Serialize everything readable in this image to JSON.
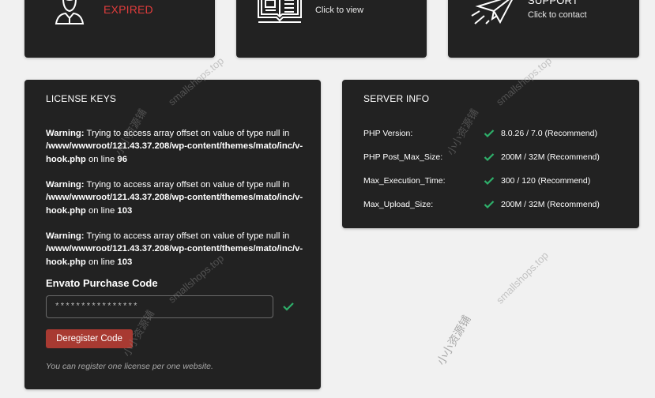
{
  "top_cards": {
    "license_status": {
      "status": "EXPIRED",
      "icon": "user-icon",
      "status_color": "#e03c3c"
    },
    "docs": {
      "subtitle": "Click to view",
      "icon": "book-icon"
    },
    "support": {
      "title": "SUPPORT",
      "subtitle": "Click to contact",
      "icon": "paper-plane-icon"
    }
  },
  "license_keys": {
    "title": "LICENSE KEYS",
    "warnings": [
      {
        "label": "Warning:",
        "message": " Trying to access array offset on value of type null in ",
        "path": "/www/wwwroot/121.43.37.208/wp-content/themes/mato/inc/v-hook.php",
        "on_line": " on line ",
        "line": "96"
      },
      {
        "label": "Warning:",
        "message": " Trying to access array offset on value of type null in ",
        "path": "/www/wwwroot/121.43.37.208/wp-content/themes/mato/inc/v-hook.php",
        "on_line": " on line ",
        "line": "103"
      },
      {
        "label": "Warning:",
        "message": " Trying to access array offset on value of type null in ",
        "path": "/www/wwwroot/121.43.37.208/wp-content/themes/mato/inc/v-hook.php",
        "on_line": " on line ",
        "line": "103"
      }
    ],
    "purchase_code_label": "Envato Purchase Code",
    "purchase_code_value": "****************",
    "deregister_label": "Deregister Code",
    "hint": "You can register one license per one website.",
    "accent_color": "#a83a32",
    "check_color": "#2eaf6a"
  },
  "server_info": {
    "title": "SERVER INFO",
    "rows": [
      {
        "label": "PHP Version:",
        "value": "8.0.26 / 7.0 (Recommend)",
        "status": "ok"
      },
      {
        "label": "PHP Post_Max_Size:",
        "value": "200M / 32M (Recommend)",
        "status": "ok"
      },
      {
        "label": "Max_Execution_Time:",
        "value": "300 / 120 (Recommend)",
        "status": "ok"
      },
      {
        "label": "Max_Upload_Size:",
        "value": "200M / 32M (Recommend)",
        "status": "ok"
      }
    ]
  },
  "watermarks": [
    "smallshops.top",
    "smallshops.top",
    "smallshops.top",
    "小小资源铺",
    "小小资源铺",
    "小小资源铺",
    "smallshops.top",
    "小小资源铺"
  ]
}
